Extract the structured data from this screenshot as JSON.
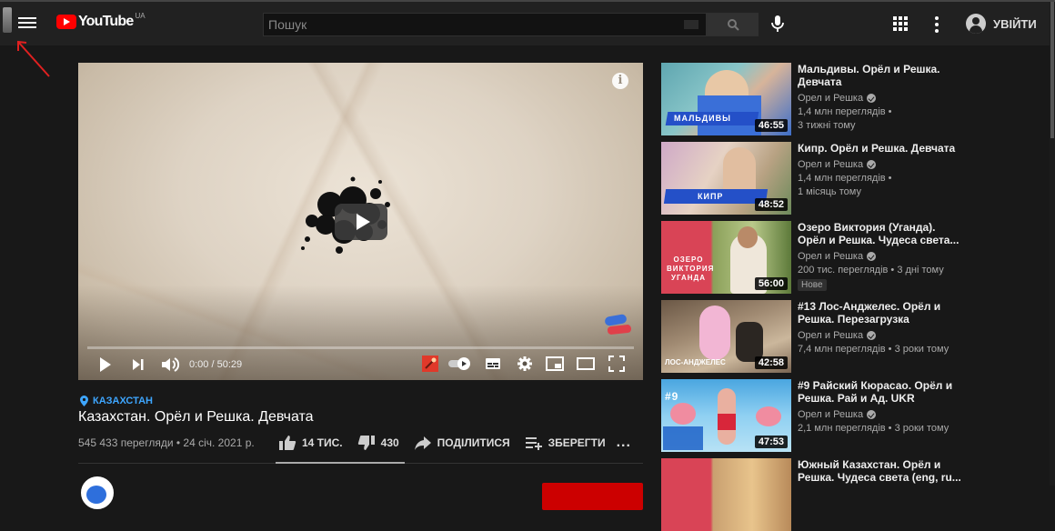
{
  "header": {
    "logo_text": "YouTube",
    "country_code": "UA",
    "search_placeholder": "Пошук",
    "search_value": "",
    "signin_label": "УВІЙТИ"
  },
  "player": {
    "time_display": "0:00 / 50:29",
    "progress_fraction": 0.0,
    "info_glyph": "i"
  },
  "video": {
    "location_tag": "КАЗАХСТАН",
    "title": "Казахстан. Орёл и Решка. Девчата",
    "meta": "545 433 перегляди • 24 січ. 2021 р.",
    "likes": "14 ТИС.",
    "dislikes": "430",
    "share_label": "ПОДІЛИТИСЯ",
    "save_label": "ЗБЕРЕГТИ",
    "more_label": "...",
    "like_ratio": 0.97
  },
  "related": [
    {
      "title": "Мальдивы. Орёл и Решка. Девчата",
      "channel": "Орел и Решка",
      "line1": "1,4 млн переглядів •",
      "line2": "3 тижні тому",
      "duration": "46:55",
      "thumb_label": "МАЛЬДИВЫ",
      "badge": ""
    },
    {
      "title": "Кипр. Орёл и Решка. Девчата",
      "channel": "Орел и Решка",
      "line1": "1,4 млн переглядів •",
      "line2": "1 місяць тому",
      "duration": "48:52",
      "thumb_label": "КИПР",
      "badge": ""
    },
    {
      "title": "Озеро Виктория (Уганда). Орёл и Решка. Чудеса света...",
      "channel": "Орел и Решка",
      "line1": "200 тис. переглядів • 3 дні тому",
      "line2": "",
      "duration": "56:00",
      "thumb_label": "ОЗЕРО ВИКТОРИЯ УГАНДА",
      "badge": "Нове"
    },
    {
      "title": "#13 Лос-Анджелес. Орёл и Решка. Перезагрузка",
      "channel": "Орел и Решка",
      "line1": "7,4 млн переглядів • 3 роки тому",
      "line2": "",
      "duration": "42:58",
      "thumb_label": "ЛОС-АНДЖЕЛЕС",
      "badge": ""
    },
    {
      "title": "#9 Райский Кюрасао. Орёл и Решка. Рай и Ад. UKR",
      "channel": "Орел и Решка",
      "line1": "2,1 млн переглядів • 3 роки тому",
      "line2": "",
      "duration": "47:53",
      "thumb_label": "#9",
      "badge": ""
    },
    {
      "title": "Южный Казахстан. Орёл и Решка. Чудеса света (eng, ru...",
      "channel": "",
      "line1": "",
      "line2": "",
      "duration": "",
      "thumb_label": "",
      "badge": ""
    }
  ],
  "colors": {
    "brand_red": "#ff0000",
    "link_blue": "#3ea6ff",
    "background": "#181818",
    "header_bg": "#212121"
  }
}
